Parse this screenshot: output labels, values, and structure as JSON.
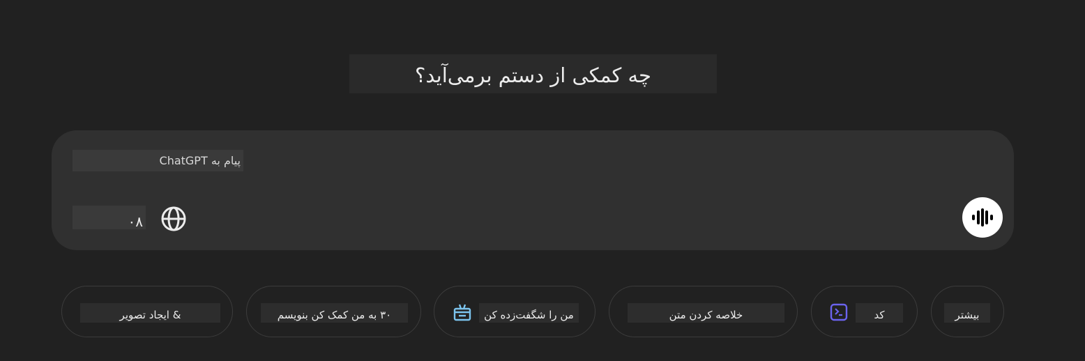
{
  "main": {
    "heading": "چه کمکی از دستم برمی‌آید؟"
  },
  "composer": {
    "placeholder": "پیام به ChatGPT",
    "model_label": "۰۸",
    "globe_icon": "globe-icon",
    "voice_icon": "voice-waveform-icon"
  },
  "suggestions": {
    "create_image": "& ایجاد تصویر",
    "help_write": "۳۰ به من کمک کن بنویسم",
    "surprise_me": "من را شگفت‌زده کن",
    "summarize": "خلاصه کردن متن",
    "code": "کد",
    "more": "بیشتر"
  },
  "colors": {
    "background": "#212121",
    "composer": "#303030",
    "surprise_icon": "#7cc4ee",
    "code_icon": "#6b63ee"
  }
}
